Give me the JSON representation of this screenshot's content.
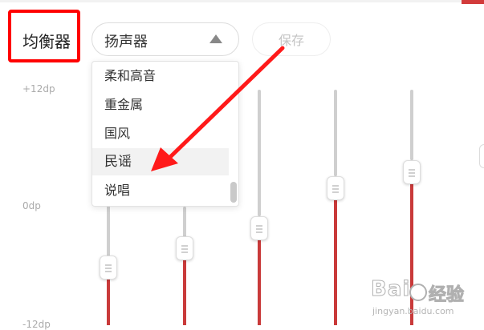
{
  "equalizer": {
    "label": "均衡器",
    "preset_select": {
      "value": "扬声器"
    },
    "save_label": "保存",
    "scale": {
      "top": "+12dp",
      "middle": "0dp",
      "bottom": "-12dp"
    },
    "dropdown": {
      "options": [
        "柔和高音",
        "重金属",
        "国风",
        "民谣",
        "说唱"
      ],
      "highlighted": "民谣"
    }
  },
  "watermark": {
    "brand": "Bai",
    "brand_tail": "经验",
    "url": "jingyan.baidu.com"
  },
  "colors": {
    "accent": "#c93a3a",
    "highlight": "#ff0000",
    "track": "#cfcfcf"
  }
}
